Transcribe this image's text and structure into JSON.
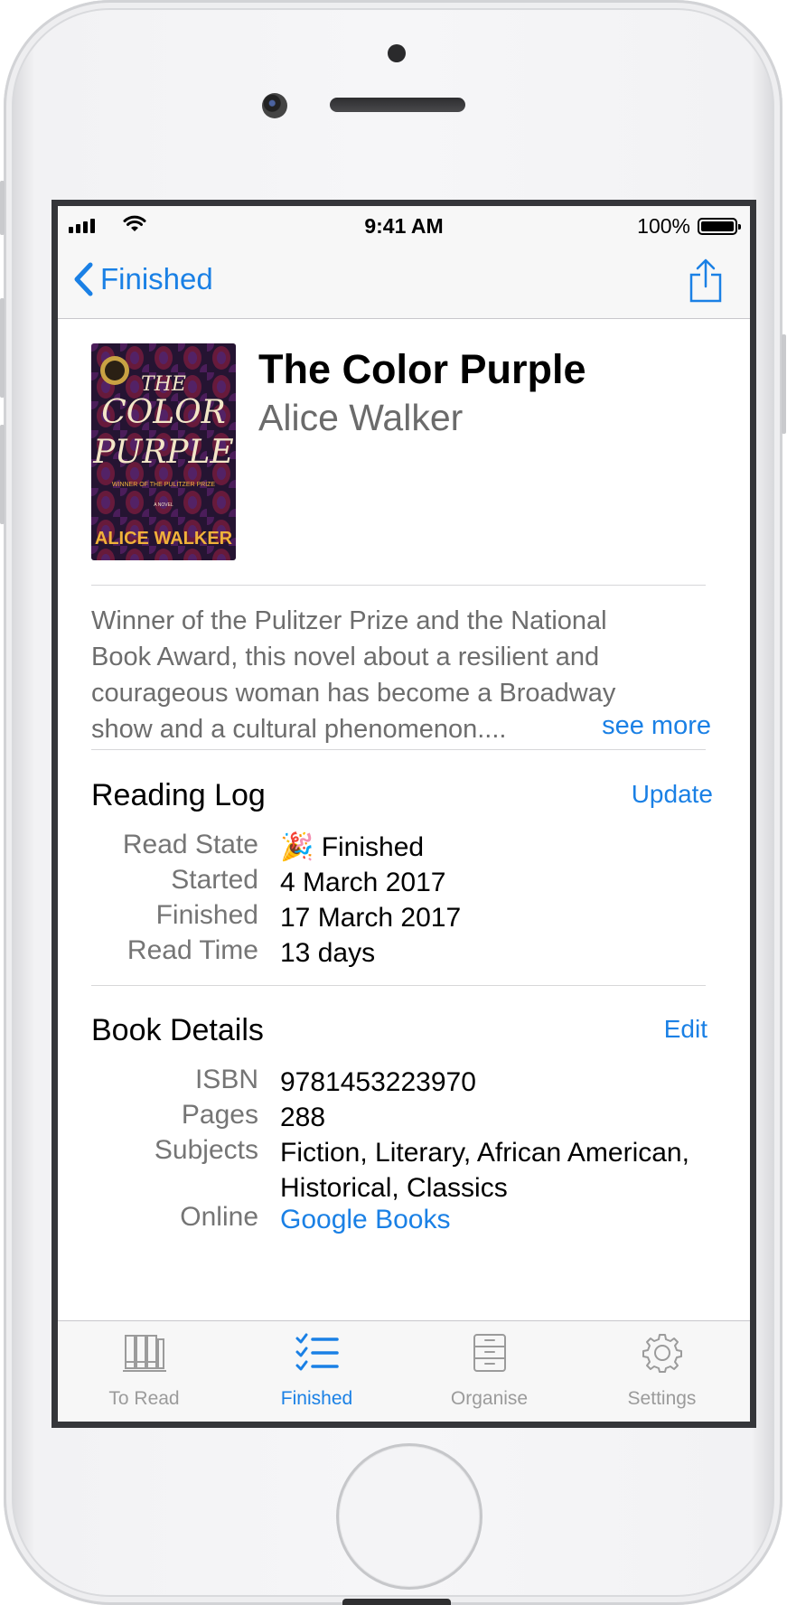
{
  "status_bar": {
    "time": "9:41 AM",
    "battery": "100%"
  },
  "nav": {
    "back_label": "Finished"
  },
  "book": {
    "title": "The Color Purple",
    "author": "Alice Walker",
    "cover": {
      "title_line1": "THE",
      "title_line2": "COLOR",
      "title_line3": "PURPLE",
      "tagline": "WINNER OF THE PULITZER PRIZE",
      "subtitle": "A NOVEL",
      "author": "ALICE WALKER"
    },
    "description_lines": [
      "Winner of the Pulitzer Prize and the National",
      "Book Award, this novel about a resilient and",
      "courageous woman has become a Broadway",
      "show and a cultural phenomenon...."
    ],
    "see_more": "see more"
  },
  "reading_log": {
    "title": "Reading Log",
    "action": "Update",
    "rows": [
      {
        "label": "Read State",
        "value": "🎉 Finished"
      },
      {
        "label": "Started",
        "value": "4 March 2017"
      },
      {
        "label": "Finished",
        "value": "17 March 2017"
      },
      {
        "label": "Read Time",
        "value": "13 days"
      }
    ]
  },
  "book_details": {
    "title": "Book Details",
    "action": "Edit",
    "rows": [
      {
        "label": "ISBN",
        "value": "9781453223970"
      },
      {
        "label": "Pages",
        "value": "288"
      },
      {
        "label": "Subjects",
        "value": "Fiction, Literary, African American, Historical, Classics"
      },
      {
        "label": "Online",
        "value": "Google Books"
      }
    ]
  },
  "tabs": [
    {
      "label": "To Read",
      "icon": "bookshelf-icon",
      "active": false
    },
    {
      "label": "Finished",
      "icon": "checklist-icon",
      "active": true
    },
    {
      "label": "Organise",
      "icon": "cabinet-icon",
      "active": false
    },
    {
      "label": "Settings",
      "icon": "gear-icon",
      "active": false
    }
  ],
  "colors": {
    "accent": "#1a80e5",
    "cover_bg": "#2a1838",
    "cover_text": "#f3e7c8",
    "cover_author": "#f0b23a"
  }
}
